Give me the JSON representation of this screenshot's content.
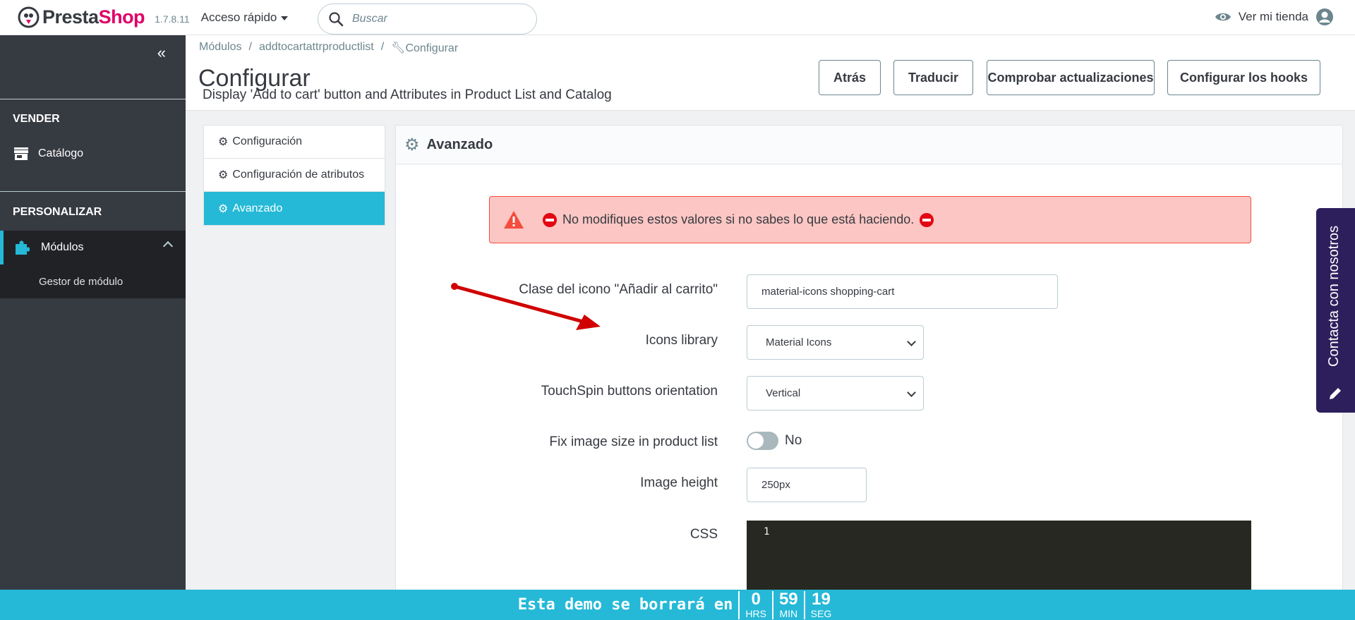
{
  "header": {
    "logo_part1": "Presta",
    "logo_part2": "Shop",
    "version": "1.7.8.11",
    "quick_access": "Acceso rápido",
    "search_placeholder": "Buscar",
    "store_link": "Ver mi tienda"
  },
  "sidebar": {
    "sections": [
      {
        "title": "VENDER",
        "items": [
          {
            "label": "Catálogo",
            "icon": "store-icon"
          }
        ]
      },
      {
        "title": "PERSONALIZAR",
        "items": [
          {
            "label": "Módulos",
            "icon": "puzzle-icon",
            "active": true
          }
        ]
      }
    ],
    "subitem": "Gestor de módulo"
  },
  "breadcrumb": [
    "Módulos",
    "addtocartattrproductlist",
    "Configurar"
  ],
  "page": {
    "title": "Configurar",
    "subtitle": "Display 'Add to cart' button and Attributes in Product List and Catalog"
  },
  "toolbar": [
    "Atrás",
    "Traducir",
    "Comprobar actualizaciones",
    "Configurar los hooks"
  ],
  "tabs": [
    "Configuración",
    "Configuración de atributos",
    "Avanzado"
  ],
  "panel": {
    "title": "Avanzado",
    "alert": "No modifiques estos valores si no sabes lo que está haciendo.",
    "fields": {
      "icon_class_label": "Clase del icono \"Añadir al carrito\"",
      "icon_class_value": "material-icons shopping-cart",
      "icons_library_label": "Icons library",
      "icons_library_value": "Material Icons",
      "touchspin_label": "TouchSpin buttons orientation",
      "touchspin_value": "Vertical",
      "fix_image_label": "Fix image size in product list",
      "fix_image_value": "No",
      "image_height_label": "Image height",
      "image_height_value": "250px",
      "css_label": "CSS",
      "css_line": "1"
    }
  },
  "contact_tab": "Contacta con nosotros",
  "demo_bar": {
    "text": "Esta demo se borrará en",
    "hours": "0",
    "hours_label": "HRS",
    "minutes": "59",
    "minutes_label": "MIN",
    "seconds": "19",
    "seconds_label": "SEG"
  },
  "colors": {
    "accent": "#25b9d7",
    "brand": "#df0067",
    "sidebar": "#363a41",
    "alert_bg": "#fbc6c3"
  }
}
